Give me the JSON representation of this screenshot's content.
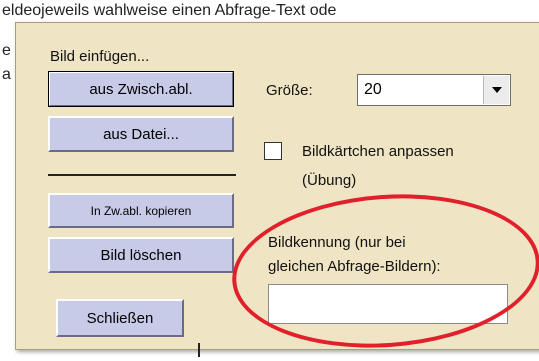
{
  "background": {
    "line1": "eldeojeweils wahlweise einen Abfrage-Text ode",
    "left_fragments": [
      "e",
      "a"
    ]
  },
  "dialog": {
    "insert_image_label": "Bild einfügen...",
    "from_clipboard_button": "aus Zwisch.abl.",
    "from_file_button": "aus Datei...",
    "copy_to_clipboard_button": "In Zw.abl. kopieren",
    "delete_image_button": "Bild löschen",
    "close_button": "Schließen",
    "size_label": "Größe:",
    "size_value": "20",
    "fit_checkbox_label_line1": "Bildkärtchen anpassen",
    "fit_checkbox_label_line2": "(Übung)",
    "fit_checked": false,
    "image_id_label_line1": "Bildkennung (nur bei",
    "image_id_label_line2": "gleichen Abfrage-Bildern):",
    "image_id_value": ""
  },
  "icons": {
    "dropdown": "chevron-down-icon"
  },
  "colors": {
    "panel_bg": "#efe5c5",
    "button_bg": "#c8cbe8",
    "highlight_ellipse": "#e0202a"
  }
}
